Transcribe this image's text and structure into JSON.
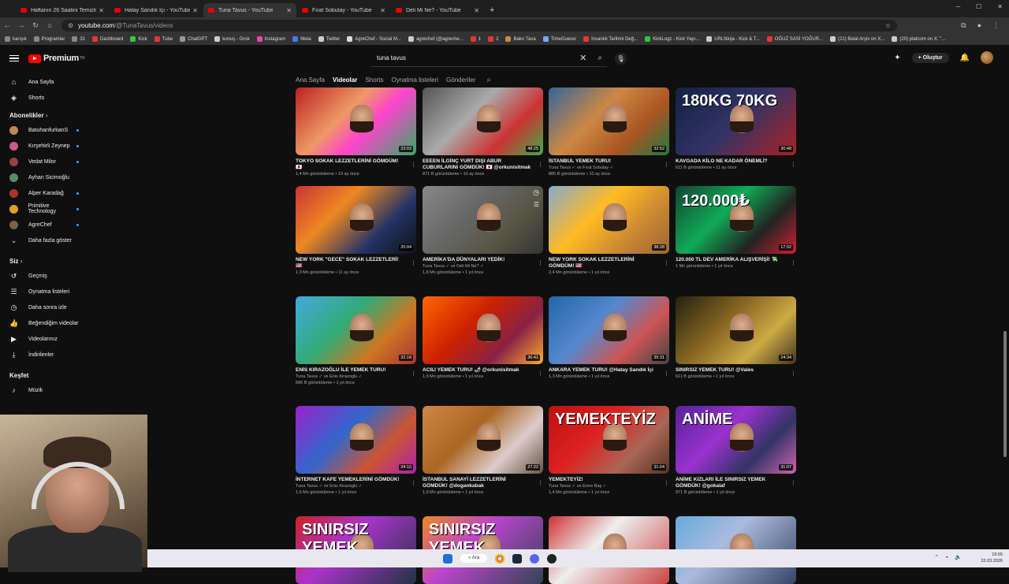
{
  "browser": {
    "tabs": [
      {
        "title": "Haftanın 26 Saatini Temizlik Yo",
        "active": false
      },
      {
        "title": "Hatay Sandık İçi - YouTube",
        "active": false
      },
      {
        "title": "Tuna Tavus - YouTube",
        "active": true
      },
      {
        "title": "Fırat Sobutay - YouTube",
        "active": false
      },
      {
        "title": "Deli Mi Ne? - YouTube",
        "active": false
      }
    ],
    "url_domain": "youtube.com",
    "url_path": "/@TunaTavus/videos",
    "bookmarks": [
      "karışık",
      "Programlar",
      "31",
      "Dashboard",
      "Kick",
      "Tube",
      "ChatGPT",
      "konuş - Grok",
      "Instagram",
      "Meta",
      "Twitter",
      "AgreChef - Social M...",
      "agrechef (@agreche...",
      "1",
      "2",
      "Bakır Tava",
      "TimeGuessr",
      "İnsanlık Tarihini Değ...",
      "KickLogz - Kick Yayı...",
      "URLNinja - Kick & T...",
      "OĞUZ SASİ YOĞUR...",
      "(21) Belal Arşiv on X...",
      "(20) platcom on X: \"..."
    ]
  },
  "youtube": {
    "logo_text": "Premium",
    "logo_sup": "TR",
    "search_value": "tuna tavus",
    "create_label": "Oluştur",
    "channel_tabs": [
      "Ana Sayfa",
      "Videolar",
      "Shorts",
      "Oynatma listeleri",
      "Gönderiler"
    ],
    "active_tab": "Videolar"
  },
  "sidebar": {
    "top": [
      {
        "label": "Ana Sayfa",
        "icon": "home-icon"
      },
      {
        "label": "Shorts",
        "icon": "shorts-icon"
      }
    ],
    "subs_header": "Abonelikler",
    "subs": [
      {
        "label": "BatuhanfurkanS",
        "color": "#c08a50",
        "dot": true
      },
      {
        "label": "Kırşehirli Zeynep",
        "color": "#c85a8a",
        "dot": true
      },
      {
        "label": "Vedat Milor",
        "color": "#9a4040",
        "dot": true
      },
      {
        "label": "Ayhan Sicimoğlu",
        "color": "#5a8a6a",
        "dot": false
      },
      {
        "label": "Alper Karadağ",
        "color": "#b03030",
        "dot": true
      },
      {
        "label": "Primitive Technology",
        "color": "#e0a020",
        "dot": true
      },
      {
        "label": "AgreChef",
        "color": "#806040",
        "dot": true
      }
    ],
    "show_more": "Daha fazla göster",
    "you_header": "Siz",
    "you": [
      {
        "label": "Geçmiş",
        "icon": "history-icon"
      },
      {
        "label": "Oynatma listeleri",
        "icon": "playlists-icon"
      },
      {
        "label": "Daha sonra izle",
        "icon": "watch-later-icon"
      },
      {
        "label": "Beğendiğim videolar",
        "icon": "like-icon"
      },
      {
        "label": "Videolarınız",
        "icon": "your-videos-icon"
      },
      {
        "label": "İndirilenler",
        "icon": "download-icon"
      }
    ],
    "explore_header": "Keşfet",
    "explore": [
      {
        "label": "Müzik",
        "icon": "music-icon"
      }
    ]
  },
  "videos": [
    {
      "title": "TOKYO SOKAK LEZZETLERİNİ GÖMDÜM! 🇯🇵",
      "line1": "1,4 Mn görüntüleme • 10 ay önce",
      "line2": "",
      "duration": "23:03",
      "bg": "linear-gradient(135deg,#b22 0%,#e96 40%,#f4c 60%,#3a6 100%)",
      "overlay": ""
    },
    {
      "title": "EEEEN İLGİNÇ YURT DIŞI ABUR CUBURLARINI GÖMDÜK! 🇯🇵 @orkunisitmak",
      "line1": "871 B görüntüleme • 10 ay önce",
      "line2": "",
      "duration": "48:25",
      "bg": "linear-gradient(135deg,#555 0%,#aaa 40%,#c33 70%,#4a4 100%)",
      "overlay": ""
    },
    {
      "title": "İSTANBUL YEMEK TURU!",
      "line1": "Tuna Tavus ✓ ve Fırat Sobutay ✓",
      "line2": "885 B görüntüleme • 10 ay önce",
      "duration": "32:52",
      "bg": "linear-gradient(135deg,#369 0%,#c84 40%,#a52 70%,#274 100%)",
      "overlay": ""
    },
    {
      "title": "KAVGADA KİLO NE KADAR ÖNEMLİ?",
      "line1": "611 B görüntüleme • 11 ay önce",
      "line2": "",
      "duration": "30:48",
      "bg": "linear-gradient(135deg,#124 0%,#336 50%,#a22 100%)",
      "overlay": "180KG 70KG"
    },
    {
      "title": "NEW YORK \"GECE\" SOKAK LEZZETLERİ! 🇺🇸",
      "line1": "1,3 Mn görüntüleme • 11 ay önce",
      "line2": "",
      "duration": "20:04",
      "bg": "linear-gradient(135deg,#c33 0%,#e82 35%,#236 70%,#111 100%)",
      "overlay": ""
    },
    {
      "title": "AMERİKA'DA DÜNYALARI YEDİK!",
      "line1": "Tuna Tavus ✓ ve Deli Mi Ne? ✓",
      "line2": "1,8 Mn görüntüleme • 1 yıl önce",
      "duration": "",
      "bg": "linear-gradient(135deg,#888 0%,#666 40%,#554 70%,#333 100%)",
      "overlay": ""
    },
    {
      "title": "NEW YORK SOKAK LEZZETLERİNİ GÖMDÜM! 🇺🇸",
      "line1": "2,4 Mn görüntüleme • 1 yıl önce",
      "line2": "",
      "duration": "38:28",
      "bg": "linear-gradient(135deg,#8ac 0%,#fb2 40%,#c83 70%,#963 100%)",
      "overlay": ""
    },
    {
      "title": "120.000 TL DEV AMERİKA ALIŞVERİŞİ! 💸",
      "line1": "1 Mn görüntüleme • 1 yıl önce",
      "line2": "",
      "duration": "17:02",
      "bg": "linear-gradient(135deg,#143 0%,#1a5 40%,#222 70%,#c23 100%)",
      "overlay": "120.000₺"
    },
    {
      "title": "ENİS KIRAZOĞLU İLE YEMEK TURU!",
      "line1": "Tuna Tavus ✓ ve Enis Kirazoglu ✓",
      "line2": "896 B görüntüleme • 1 yıl önce",
      "duration": "32:18",
      "bg": "linear-gradient(135deg,#4ad 0%,#3a7 40%,#c72 70%,#a33 100%)",
      "overlay": ""
    },
    {
      "title": "ACILI YEMEK TURU! 🌶 @orkunisitmak",
      "line1": "1,9 Mn görüntüleme • 1 yıl önce",
      "line2": "",
      "duration": "36:41",
      "bg": "linear-gradient(135deg,#f60 0%,#c20 40%,#824 70%,#fa3 100%)",
      "overlay": ""
    },
    {
      "title": "ANKARA YEMEK TURU! @Hatay Sandık İçi",
      "line1": "1,3 Mn görüntüleme • 1 yıl önce",
      "line2": "",
      "duration": "35:31",
      "bg": "linear-gradient(135deg,#26a 0%,#58c 40%,#c55 70%,#444 100%)",
      "overlay": ""
    },
    {
      "title": "SINIRSIZ YEMEK TURU! @Vales",
      "line1": "611 B görüntüleme • 1 yıl önce",
      "line2": "",
      "duration": "24:34",
      "bg": "linear-gradient(135deg,#221 0%,#862 40%,#ca4 70%,#432 100%)",
      "overlay": ""
    },
    {
      "title": "İNTERNET KAFE YEMEKLERİNİ GÖMDÜK!",
      "line1": "Tuna Tavus ✓ ve Enis Kirazoglu ✓",
      "line2": "1,6 Mn görüntüleme • 1 yıl önce",
      "duration": "34:15",
      "bg": "linear-gradient(135deg,#92c 0%,#36c 40%,#c53 70%,#a2a 100%)",
      "overlay": ""
    },
    {
      "title": "İSTANBUL SANAYİ LEZZETLERİNİ GÖMDÜK! @dogankabak",
      "line1": "1,9 Mn görüntüleme • 1 yıl önce",
      "line2": "",
      "duration": "27:22",
      "bg": "linear-gradient(135deg,#c84 0%,#a62 40%,#dcc 70%,#654 100%)",
      "overlay": ""
    },
    {
      "title": "YEMEKTEYİZ!",
      "line1": "Tuna Tavus ✓ ve Emre Baş ✓",
      "line2": "1,4 Mn görüntüleme • 1 yıl önce",
      "duration": "31:04",
      "bg": "linear-gradient(135deg,#b11 0%,#d22 40%,#a65 70%,#532 100%)",
      "overlay": "YEMEKTEYİZ"
    },
    {
      "title": "ANİME KIZLARI İLE SINIRSIZ YEMEK GÖMDÜK! @gokalaf",
      "line1": "971 B görüntüleme • 1 yıl önce",
      "line2": "",
      "duration": "31:07",
      "bg": "linear-gradient(135deg,#529 0%,#93c 40%,#336 70%,#c6a 100%)",
      "overlay": "ANİME"
    },
    {
      "title": "",
      "line1": "",
      "line2": "",
      "duration": "",
      "bg": "linear-gradient(135deg,#c22 0%,#a3c 40%,#234 100%)",
      "overlay": "SINIRSIZ YEMEK"
    },
    {
      "title": "",
      "line1": "",
      "line2": "",
      "duration": "",
      "bg": "linear-gradient(135deg,#e82 0%,#b4c 40%,#345 100%)",
      "overlay": "SINIRSIZ YEMEK"
    },
    {
      "title": "",
      "line1": "",
      "line2": "",
      "duration": "",
      "bg": "linear-gradient(135deg,#c33 0%,#eee 40%,#c44 100%)",
      "overlay": ""
    },
    {
      "title": "",
      "line1": "",
      "line2": "",
      "duration": "",
      "bg": "linear-gradient(135deg,#6ad 0%,#abd 40%,#346 100%)",
      "overlay": ""
    }
  ],
  "taskbar": {
    "search_label": "Ara",
    "time": "19:55",
    "date": "22.03.2026"
  }
}
